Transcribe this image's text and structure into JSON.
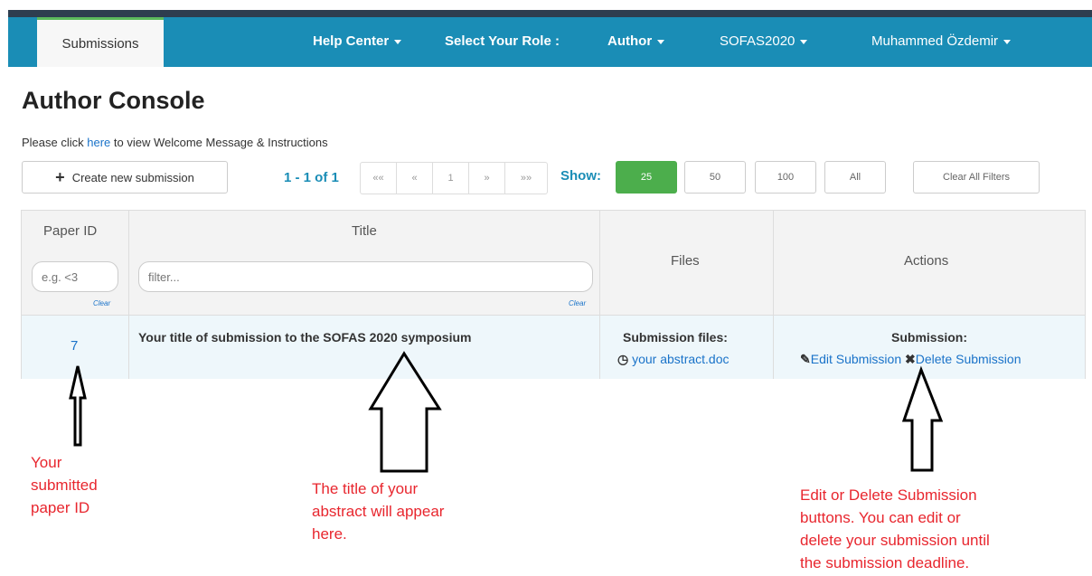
{
  "navbar": {
    "active_tab": "Submissions",
    "help_center": "Help Center",
    "role_label": "Select Your Role :",
    "role_value": "Author",
    "conference": "SOFAS2020",
    "user": "Muhammed Özdemir"
  },
  "page": {
    "title": "Author Console",
    "welcome_prefix": "Please click ",
    "welcome_link": "here",
    "welcome_suffix": " to view Welcome Message & Instructions"
  },
  "toolbar": {
    "create_label": "Create new submission",
    "paging_summary": "1 - 1 of 1",
    "pager_buttons": [
      "««",
      "«",
      "1",
      "»",
      "»»"
    ],
    "show_label": "Show:",
    "page_sizes": [
      "25",
      "50",
      "100",
      "All"
    ],
    "active_page_size": "25",
    "clear_filters_label": "Clear All Filters"
  },
  "table": {
    "columns": [
      "Paper ID",
      "Title",
      "Files",
      "Actions"
    ],
    "paper_id_placeholder": "e.g. <3",
    "title_placeholder": "filter...",
    "clear_label": "Clear",
    "rows": [
      {
        "paper_id": "7",
        "title": "Your title of submission to the SOFAS 2020 symposium",
        "files_header": "Submission files:",
        "file_name": "your abstract.doc",
        "actions_header": "Submission:",
        "edit_label": "Edit Submission",
        "delete_label": "Delete Submission"
      }
    ]
  },
  "annotations": {
    "paper_id_note": [
      "Your",
      "submitted",
      "paper ID"
    ],
    "title_note": [
      "The title of your",
      "abstract will appear",
      "here."
    ],
    "actions_note": [
      "Edit or Delete Submission",
      "buttons. You can edit or",
      "delete your submission until",
      "the submission deadline."
    ]
  },
  "colors": {
    "navbar": "#1a8db6",
    "dark_band": "#2e3d4f",
    "active_green": "#4cae4c",
    "link_blue": "#1a73c9",
    "annotation_red": "#e8262e"
  }
}
